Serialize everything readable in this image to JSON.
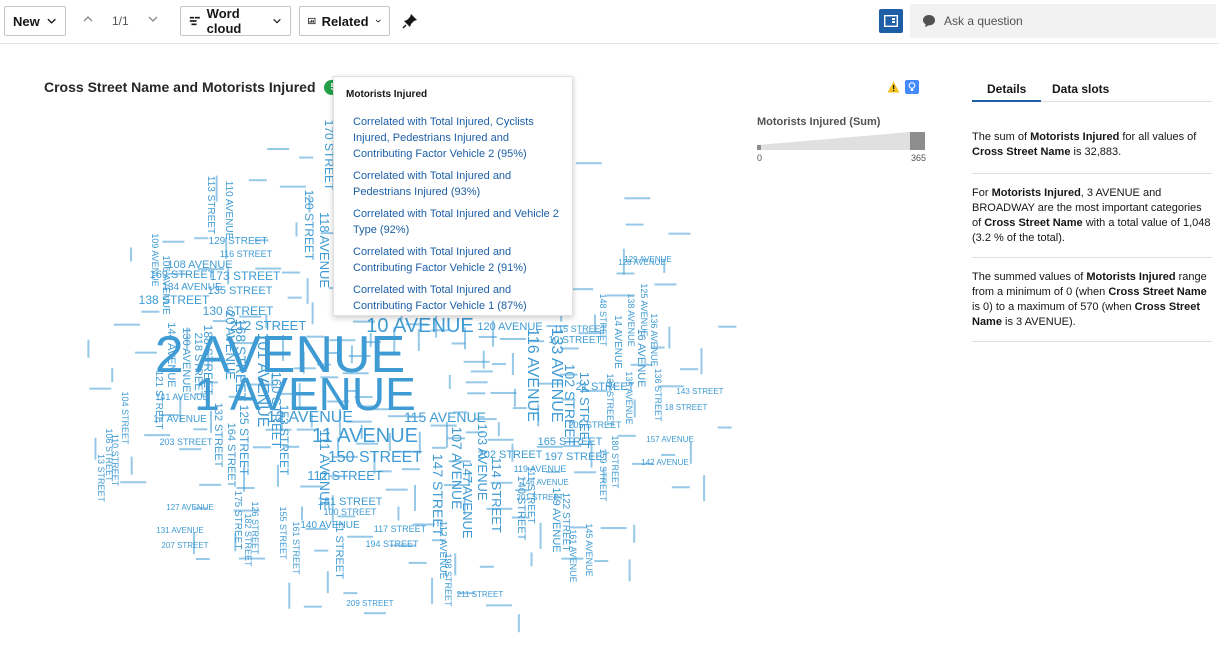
{
  "toolbar": {
    "new_label": "New",
    "page_indicator": "1/1",
    "visualization_label": "Word cloud",
    "related_label": "Related",
    "ask_placeholder": "Ask a question"
  },
  "chart": {
    "title": "Cross Street Name and Motorists Injured",
    "badge_count": "5"
  },
  "tooltip": {
    "title": "Motorists Injured",
    "items": [
      "Correlated with Total Injured, Cyclists Injured, Pedestrians Injured and Contributing Factor Vehicle 2 (95%)",
      "Correlated with Total Injured and Pedestrians Injured (93%)",
      "Correlated with Total Injured and Vehicle 2 Type (92%)",
      "Correlated with Total Injured and Contributing Factor Vehicle 2 (91%)",
      "Correlated with Total Injured and Contributing Factor Vehicle 1 (87%)"
    ]
  },
  "legend": {
    "title": "Motorists Injured (Sum)",
    "min": "0",
    "max": "365"
  },
  "details": {
    "tabs": [
      "Details",
      "Data slots"
    ],
    "insight1": {
      "p1": "The sum of ",
      "b1": "Motorists Injured",
      "p2": " for all values of ",
      "b2": "Cross Street Name",
      "p3": " is 32,883."
    },
    "insight2": {
      "p1": "For ",
      "b1": "Motorists Injured",
      "p2": ", 3 AVENUE and BROADWAY are the most important categories of ",
      "b2": "Cross Street Name",
      "p3": " with a total value of 1,048 (3.2 % of the total)."
    },
    "insight3": {
      "p1": "The summed values of ",
      "b1": "Motorists Injured",
      "p2": " range from a minimum of 0 (when ",
      "b2": "Cross Street Name",
      "p3": " is 0) to a maximum of 570 (when ",
      "b3": "Cross Street Name",
      "p4": " is 3 AVENUE)."
    }
  },
  "colors": {
    "word": "#3f9bd4",
    "accent": "#1d5fa6",
    "badge": "#24a148",
    "warning": "#f1c21b"
  },
  "chart_data": {
    "type": "wordcloud",
    "words": [
      "2 AVENUE",
      "1 AVENUE",
      "10 AVENUE",
      "11 AVENUE",
      "150 STREET",
      "12 AVENUE",
      "115 AVENUE",
      "212 STREET",
      "120 AVENUE",
      "116 AVENUE",
      "133 AVENUE",
      "102 STREET",
      "134 STREET",
      "107 AVENUE",
      "103 AVENUE",
      "114 STREET",
      "111 AVENUE",
      "101 AVENUE",
      "168 STREET",
      "160 STREET",
      "153 STREET",
      "125 STREET",
      "164 STREET",
      "132 STREET",
      "20 AVENUE",
      "188 STREET",
      "218 STREET",
      "130 AVENUE",
      "144 AVENUE",
      "173 STREET",
      "135 STREET",
      "138 STREET",
      "169 STREET",
      "130 STREET",
      "108 AVENUE",
      "134 AVENUE",
      "129 STREET",
      "116 STREET",
      "110 AVENUE",
      "113 STREET",
      "120 STREET",
      "118 AVENUE",
      "170 STREET",
      "17 AVENUE",
      "141 AVENUE",
      "121 STREET",
      "203 STREET",
      "202 STREET",
      "112 STREET",
      "181 STREET",
      "100 STREET",
      "140 AVENUE",
      "117 STREET",
      "147 STREET",
      "165 STREET",
      "197 STREET",
      "21 STREET",
      "205 STREET",
      "115 STREET",
      "10 STREET",
      "14 AVENUE",
      "111 STREET",
      "148 STREET",
      "16 AVENUE",
      "106 AVENUE",
      "147 AVENUE",
      "194 STREET",
      "11 STREET",
      "112 AVENUE",
      "211 STREET",
      "209 STREET",
      "207 STREET",
      "131 AVENUE",
      "127 AVENUE",
      "119 AVENUE",
      "146 AVENUE",
      "201 STREET",
      "140 STREET",
      "149 AVENUE",
      "129 AVENUE",
      "135 AVENUE",
      "137 STREET",
      "157 AVENUE",
      "142 AVENUE",
      "136 AVENUE",
      "180 STREET",
      "159 STREET",
      "122 STREET",
      "109 AVENUE",
      "104 STREET",
      "175 STREET",
      "182 STREET",
      "126 STREET",
      "155 STREET",
      "161 STREET",
      "13 STREET",
      "106 STREET",
      "110 STREET",
      "138 AVENUE",
      "125 AVENUE",
      "145 AVENUE",
      "198 STREET",
      "161 AVENUE",
      "143 STREET",
      "136 STREET",
      "18 STREET",
      "128 AVENUE"
    ]
  }
}
